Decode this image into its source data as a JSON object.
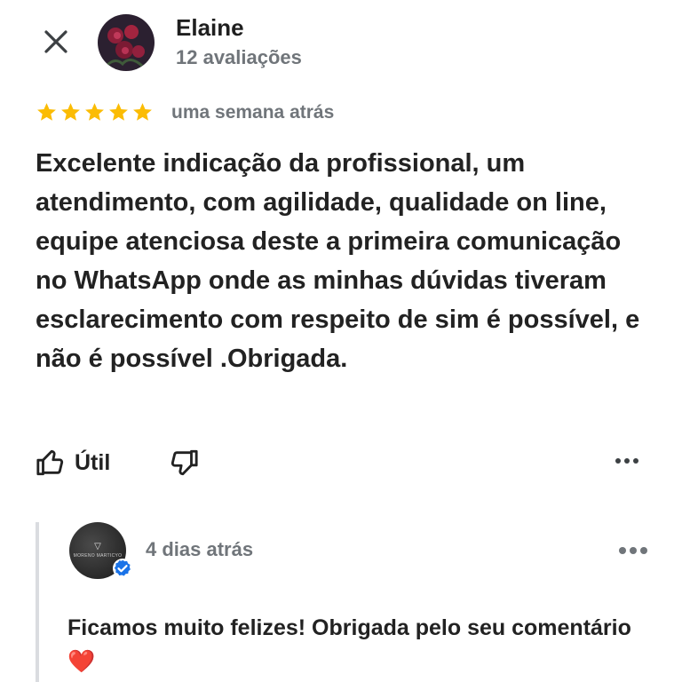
{
  "review": {
    "reviewer_name": "Elaine",
    "review_count": "12 avaliações",
    "rating": 5,
    "date": "uma semana atrás",
    "text": "Excelente indicação da profissional, um atendimento, com agilidade, qualidade on line, equipe atenciosa deste a primeira comunicação no WhatsApp onde as minhas dúvidas tiveram esclarecimento com respeito de sim é possível, e não é possível .Obrigada.",
    "helpful_label": "Útil"
  },
  "owner_reply": {
    "date": "4 dias atrás",
    "text": "Ficamos muito felizes!   Obrigada pelo seu comentário",
    "emoji": "❤️",
    "logo_text": "MORENO MARTICYO"
  },
  "icons": {
    "close": "close-icon",
    "star": "star-icon",
    "thumbs_up": "thumbs-up-icon",
    "thumbs_down": "thumbs-down-icon",
    "more": "more-dots-icon",
    "verified": "verified-badge-icon"
  },
  "colors": {
    "star": "#fbbc04",
    "secondary_text": "#70757a",
    "verified": "#1a73e8",
    "reply_border": "#dadce0"
  }
}
